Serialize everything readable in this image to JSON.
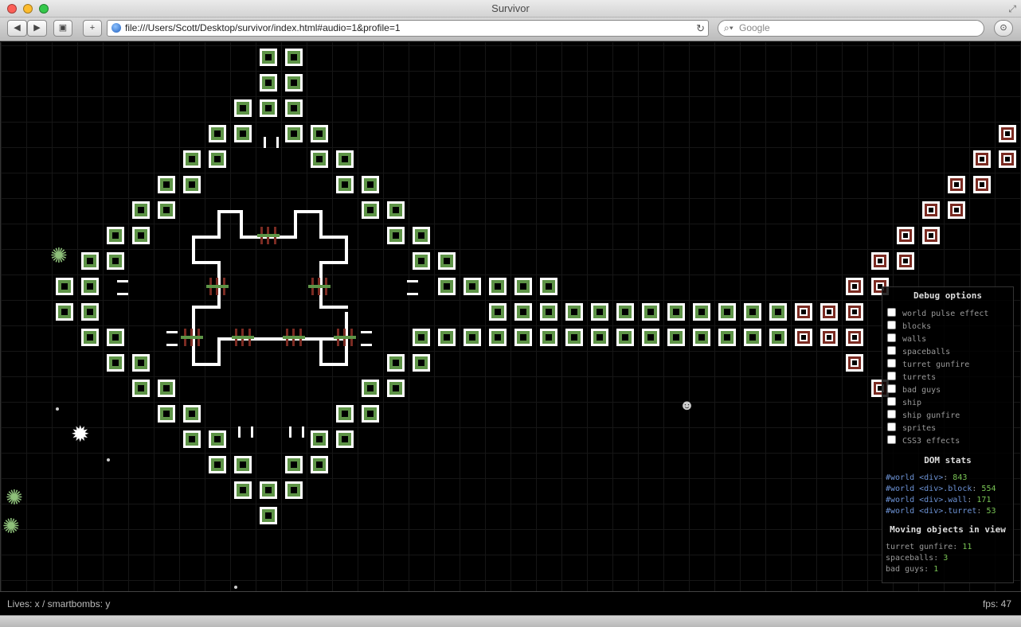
{
  "window": {
    "title": "Survivor",
    "url": "file:///Users/Scott/Desktop/survivor/index.html#audio=1&profile=1",
    "search_placeholder": "Google"
  },
  "status": {
    "lives": "Lives: x / smartbombs: y",
    "fps": "fps: 47"
  },
  "debug": {
    "title": "Debug options",
    "options": [
      "world pulse effect",
      "blocks",
      "walls",
      "spaceballs",
      "turret gunfire",
      "turrets",
      "bad guys",
      "ship",
      "ship gunfire",
      "sprites",
      "CSS3 effects"
    ],
    "dom_title": "DOM stats",
    "dom_stats": [
      {
        "selector": "#world <div>",
        "value": "843"
      },
      {
        "selector": "#world <div>.block",
        "value": "554"
      },
      {
        "selector": "#world <div>.wall",
        "value": "171"
      },
      {
        "selector": "#world <div>.turret",
        "value": "53"
      }
    ],
    "moving_title": "Moving objects in view",
    "moving": [
      {
        "label": "turret gunfire",
        "value": "11"
      },
      {
        "label": "spaceballs",
        "value": "3"
      },
      {
        "label": "bad guys",
        "value": "1"
      }
    ]
  },
  "colors": {
    "block_green": "#5e9447",
    "block_red": "#7b2b22",
    "turret_green": "#5e9447",
    "turret_red": "#7b2b22",
    "debug_selector": "#6d93d6",
    "debug_value": "#79c454"
  }
}
